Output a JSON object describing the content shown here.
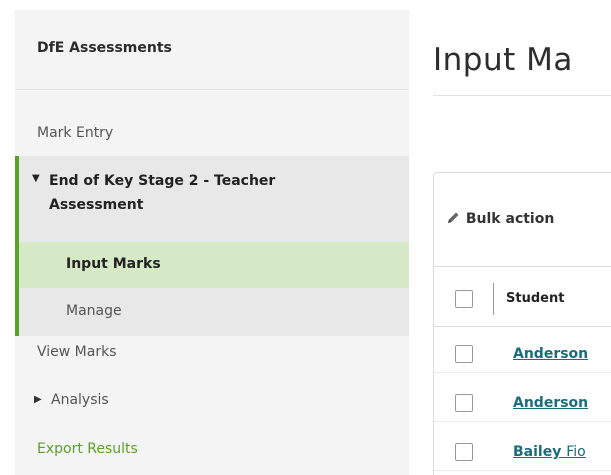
{
  "sidebar": {
    "header": "DfE Assessments",
    "items": {
      "mark_entry": "Mark Entry",
      "section_title": "End of Key Stage 2 - Teacher Assessment",
      "input_marks": "Input Marks",
      "manage": "Manage",
      "view_marks": "View Marks",
      "analysis": "Analysis",
      "export_results": "Export Results"
    },
    "accent_color": "#5aa02c",
    "active_bg": "#d5e9c7"
  },
  "main": {
    "title": "Input Ma",
    "bulk_actions": "Bulk action",
    "table": {
      "header": {
        "student": "Student"
      },
      "rows": [
        {
          "surname": "Anderson",
          "firstname": ""
        },
        {
          "surname": "Anderson",
          "firstname": ""
        },
        {
          "surname": "Bailey",
          "firstname": "Fio"
        }
      ]
    },
    "link_color": "#1b6c7b"
  },
  "icons": {
    "caret_down": "caret-down-icon",
    "caret_right": "caret-right-icon",
    "pencil": "pencil-icon"
  }
}
